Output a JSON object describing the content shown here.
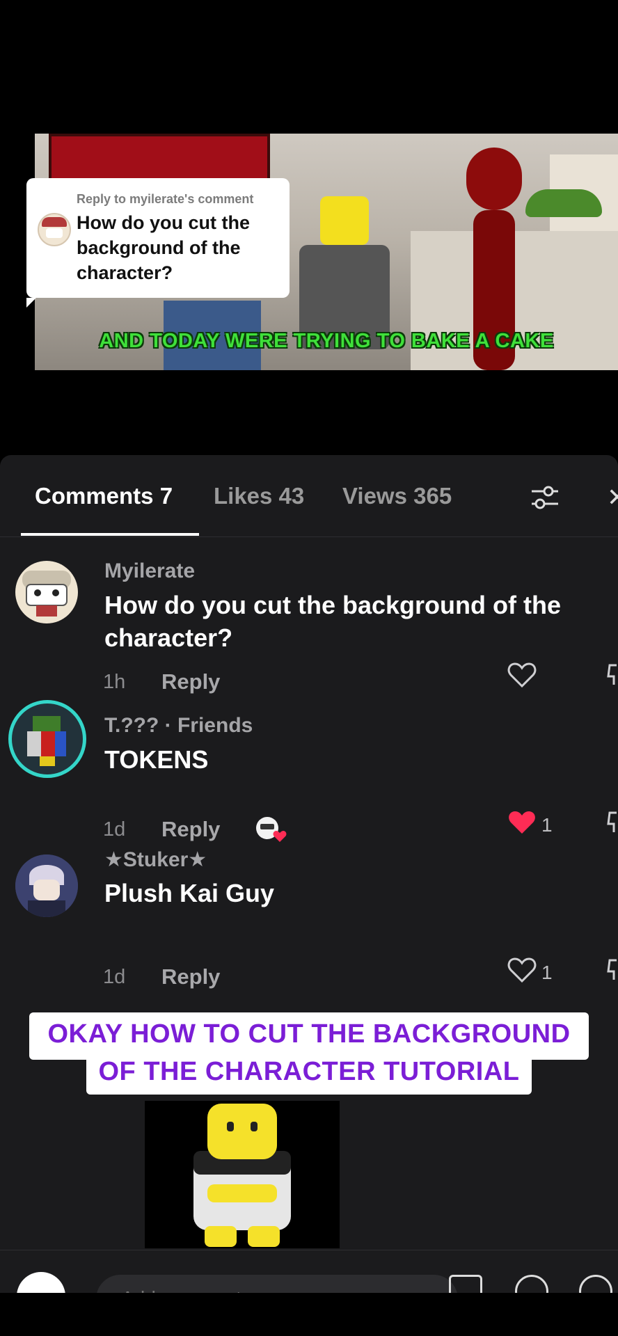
{
  "video": {
    "caption": "AND TODAY WERE TRYING TO BAKE A CAKE"
  },
  "reply_bubble": {
    "label": "Reply to myilerate's comment",
    "text": "How do you cut the background of the character?"
  },
  "tabs": [
    {
      "label": "Comments 7",
      "active": true
    },
    {
      "label": "Likes 43",
      "active": false
    },
    {
      "label": "Views 365",
      "active": false
    }
  ],
  "filter_icon": "sliders-icon",
  "close_icon": "close-icon",
  "comments": [
    {
      "name": "Myilerate",
      "text": "How do you cut the background of the character?",
      "time": "1h",
      "reply": "Reply",
      "likes": "",
      "liked": false
    },
    {
      "name": "T.??? · Friends",
      "text": "TOKENS",
      "time": "1d",
      "reply": "Reply",
      "likes": "1",
      "liked": true
    },
    {
      "name": "★Stuker★",
      "text": "Plush Kai Guy",
      "time": "1d",
      "reply": "Reply",
      "likes": "1",
      "liked": false
    }
  ],
  "tutorial": {
    "line1": "OKAY HOW TO CUT THE BACKGROUND",
    "line2": "OF THE CHARACTER TUTORIAL"
  },
  "input": {
    "placeholder": "Add comment..."
  },
  "colors": {
    "panel_bg": "#1b1b1d",
    "like_red": "#fe2c55",
    "caption_green": "#3fe03a",
    "tutorial_purple": "#7b1ed6"
  }
}
